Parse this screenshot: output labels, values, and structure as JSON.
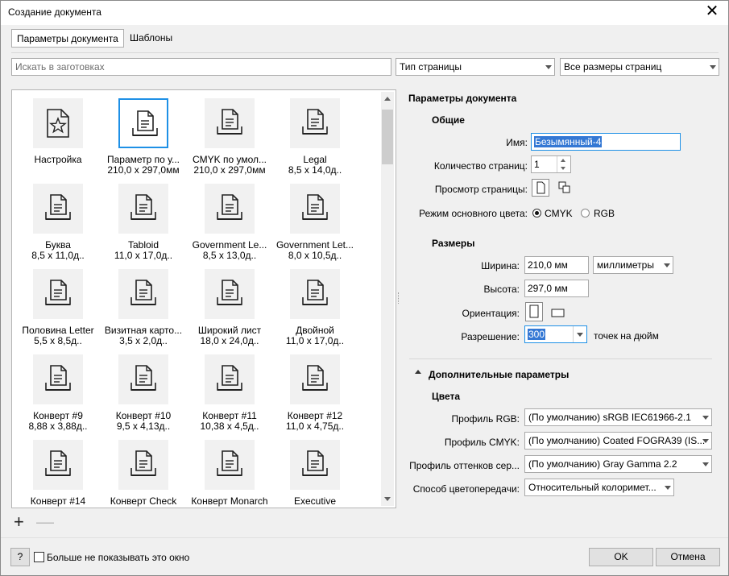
{
  "window": {
    "title": "Создание документа",
    "close_glyph": "✕"
  },
  "tabs": [
    {
      "label": "Параметры документа"
    },
    {
      "label": "Шаблоны"
    }
  ],
  "search": {
    "placeholder": "Искать в заготовках"
  },
  "filters": {
    "page_type": "Тип страницы",
    "page_sizes": "Все размеры страниц"
  },
  "presets": [
    {
      "name": "Настройка",
      "size": "",
      "icon": "star-page-icon"
    },
    {
      "name": "Параметр по у...",
      "size": "210,0 x 297,0мм",
      "icon": "printer-page-icon",
      "selected": true
    },
    {
      "name": "CMYK по умол...",
      "size": "210,0 x 297,0мм",
      "icon": "printer-page-icon"
    },
    {
      "name": "Legal",
      "size": "8,5 x 14,0д..",
      "icon": "printer-page-icon"
    },
    {
      "name": "Буква",
      "size": "8,5 x 11,0д..",
      "icon": "printer-page-icon"
    },
    {
      "name": "Tabloid",
      "size": "11,0 x 17,0д..",
      "icon": "printer-page-icon"
    },
    {
      "name": "Government Le...",
      "size": "8,5 x 13,0д..",
      "icon": "printer-page-icon"
    },
    {
      "name": "Government Let...",
      "size": "8,0 x 10,5д..",
      "icon": "printer-page-icon"
    },
    {
      "name": "Половина Letter",
      "size": "5,5 x 8,5д..",
      "icon": "printer-page-icon"
    },
    {
      "name": "Визитная карто...",
      "size": "3,5 x 2,0д..",
      "icon": "printer-page-icon"
    },
    {
      "name": "Широкий лист",
      "size": "18,0 x 24,0д..",
      "icon": "printer-page-icon"
    },
    {
      "name": "Двойной",
      "size": "11,0 x 17,0д..",
      "icon": "printer-page-icon"
    },
    {
      "name": "Конверт #9",
      "size": "8,88 x 3,88д..",
      "icon": "printer-page-icon"
    },
    {
      "name": "Конверт #10",
      "size": "9,5 x 4,13д..",
      "icon": "printer-page-icon"
    },
    {
      "name": "Конверт #11",
      "size": "10,38 x 4,5д..",
      "icon": "printer-page-icon"
    },
    {
      "name": "Конверт #12",
      "size": "11,0 x 4,75д..",
      "icon": "printer-page-icon"
    },
    {
      "name": "Конверт #14",
      "size": "",
      "icon": "printer-page-icon"
    },
    {
      "name": "Конверт Check",
      "size": "",
      "icon": "printer-page-icon"
    },
    {
      "name": "Конверт Monarch",
      "size": "",
      "icon": "printer-page-icon"
    },
    {
      "name": "Executive",
      "size": "",
      "icon": "printer-page-icon"
    }
  ],
  "gallery_controls": {
    "add": "+",
    "remove": "—"
  },
  "settings": {
    "title": "Параметры документа",
    "general": {
      "heading": "Общие",
      "name_label": "Имя:",
      "name_value": "Безымянный-4",
      "pages_label": "Количество страниц:",
      "pages_value": "1",
      "preview_label": "Просмотр страницы:",
      "color_mode_label": "Режим основного цвета:",
      "color_mode_options": [
        "CMYK",
        "RGB"
      ],
      "color_mode_selected": "CMYK"
    },
    "sizes": {
      "heading": "Размеры",
      "width_label": "Ширина:",
      "width_value": "210,0 мм",
      "units_value": "миллиметры",
      "height_label": "Высота:",
      "height_value": "297,0 мм",
      "orientation_label": "Ориентация:",
      "resolution_label": "Разрешение:",
      "resolution_value": "300",
      "resolution_unit": "точек на дюйм"
    },
    "advanced": {
      "heading": "Дополнительные параметры",
      "colors_heading": "Цвета",
      "rgb_label": "Профиль RGB:",
      "rgb_value": "(По умолчанию) sRGB IEC61966-2.1",
      "cmyk_label": "Профиль CMYK:",
      "cmyk_value": "(По умолчанию) Coated FOGRA39 (IS...",
      "gray_label": "Профиль оттенков сер...",
      "gray_value": "(По умолчанию) Gray Gamma 2.2",
      "intent_label": "Способ цветопередачи:",
      "intent_value": "Относительный колоримет..."
    }
  },
  "footer": {
    "help": "?",
    "dont_show": "Больше не показывать это окно",
    "ok": "OK",
    "cancel": "Отмена"
  },
  "colors": {
    "selection_border": "#1e90e6",
    "field_highlight": "#3478d4"
  }
}
